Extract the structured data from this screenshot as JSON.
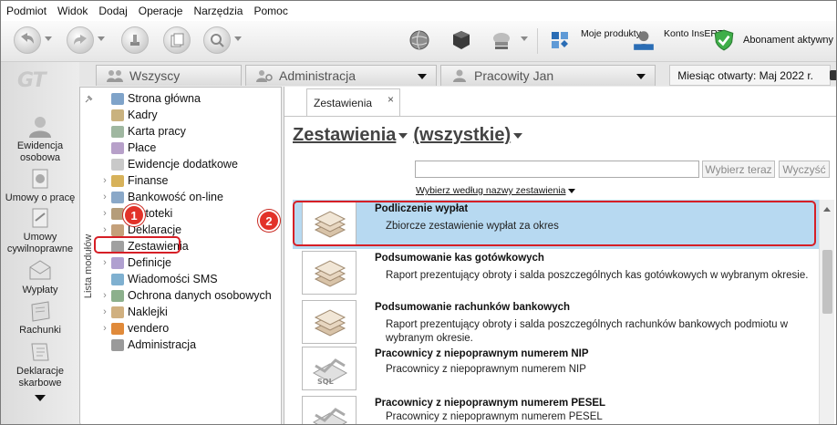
{
  "menu": [
    "Podmiot",
    "Widok",
    "Dodaj",
    "Operacje",
    "Narzędzia",
    "Pomoc"
  ],
  "toolbar": {
    "moje_produkty": "Moje produkty",
    "konto_insert": "Konto InsERT",
    "insert_tag": "InsERT",
    "abonament": "Abonament aktywny"
  },
  "rail": {
    "logo": "GT",
    "items": [
      "Ewidencja osobowa",
      "Umowy o pracę",
      "Umowy cywilnoprawne",
      "Wypłaty",
      "Rachunki",
      "Deklaracje skarbowe"
    ]
  },
  "tabs": {
    "wszyscy": "Wszyscy",
    "administracja": "Administracja",
    "pracowity": "Pracowity Jan",
    "month_label": "Miesiąc otwarty:",
    "month_value": "Maj 2022 r."
  },
  "modules": {
    "panel_title": "Lista modułów",
    "items": [
      {
        "label": "Strona główna",
        "exp": ""
      },
      {
        "label": "Kadry",
        "exp": ""
      },
      {
        "label": "Karta pracy",
        "exp": ""
      },
      {
        "label": "Płace",
        "exp": ""
      },
      {
        "label": "Ewidencje dodatkowe",
        "exp": ""
      },
      {
        "label": "Finanse",
        "exp": "›"
      },
      {
        "label": "Bankowość on-line",
        "exp": "›"
      },
      {
        "label": "Kartoteki",
        "exp": "›"
      },
      {
        "label": "Deklaracje",
        "exp": "›"
      },
      {
        "label": "Zestawienia",
        "exp": ""
      },
      {
        "label": "Definicje",
        "exp": "›"
      },
      {
        "label": "Wiadomości SMS",
        "exp": ""
      },
      {
        "label": "Ochrona danych osobowych",
        "exp": "›"
      },
      {
        "label": "Naklejki",
        "exp": "›"
      },
      {
        "label": "vendero",
        "exp": "›"
      },
      {
        "label": "Administracja",
        "exp": ""
      }
    ]
  },
  "badges": {
    "one": "1",
    "two": "2"
  },
  "content": {
    "tab_label": "Zestawienia",
    "tab_close": "×",
    "heading_main": "Zestawienia",
    "heading_filter": "(wszystkie)",
    "search_button": "Wybierz teraz",
    "clear_button": "Wyczyść",
    "filter_link": "Wybierz według nazwy zestawienia",
    "reports": [
      {
        "title": "Podliczenie wypłat",
        "desc": "Zbiorcze zestawienie wypłat za okres"
      },
      {
        "title": "Podsumowanie kas gotówkowych",
        "desc": "Raport prezentujący obroty i salda poszczególnych kas gotówkowych w wybranym okresie."
      },
      {
        "title": "Podsumowanie rachunków bankowych",
        "desc": "Raport prezentujący obroty i salda poszczególnych rachunków bankowych podmiotu w wybranym okresie."
      },
      {
        "title": "Pracownicy z niepoprawnym numerem NIP",
        "desc": "Pracownicy z niepoprawnym numerem NIP"
      },
      {
        "title": "Pracownicy z niepoprawnym numerem PESEL",
        "desc": "Pracownicy z niepoprawnym numerem PESEL"
      }
    ]
  }
}
